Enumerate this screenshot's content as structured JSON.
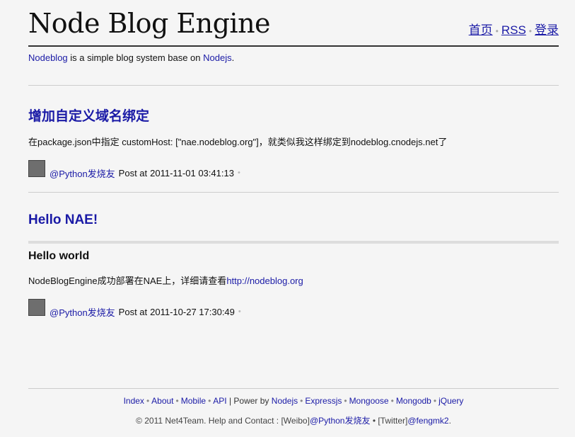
{
  "header": {
    "title": "Node Blog Engine",
    "nav": {
      "home": "首页",
      "rss": "RSS",
      "login": "登录"
    }
  },
  "tagline": {
    "link1": "Nodeblog",
    "mid": " is a simple blog system base on ",
    "link2": "Nodejs",
    "end": "."
  },
  "posts": [
    {
      "title": "增加自定义域名绑定",
      "body": "在package.json中指定 customHost: [\"nae.nodeblog.org\"]，就类似我这样绑定到nodeblog.cnodejs.net了",
      "author": "@Python发烧友",
      "post_at_label": "Post at",
      "timestamp": "2011-11-01 03:41:13"
    },
    {
      "title": "Hello NAE!",
      "heading": "Hello world",
      "body_text": "NodeBlogEngine成功部署在NAE上，详细请查看",
      "body_link": "http://nodeblog.org",
      "author": "@Python发烧友",
      "post_at_label": "Post at",
      "timestamp": "2011-10-27 17:30:49"
    }
  ],
  "footer": {
    "links": [
      "Index",
      "About",
      "Mobile",
      "API"
    ],
    "power_label": "| Power by",
    "tech": [
      "Nodejs",
      "Expressjs",
      "Mongoose",
      "Mongodb",
      "jQuery"
    ],
    "copyright": "© 2011 Net4Team. Help and Contact : [Weibo]",
    "weibo": "@Python发烧友",
    "twitter_label": "• [Twitter]",
    "twitter": "@fengmk2",
    "end": "."
  }
}
